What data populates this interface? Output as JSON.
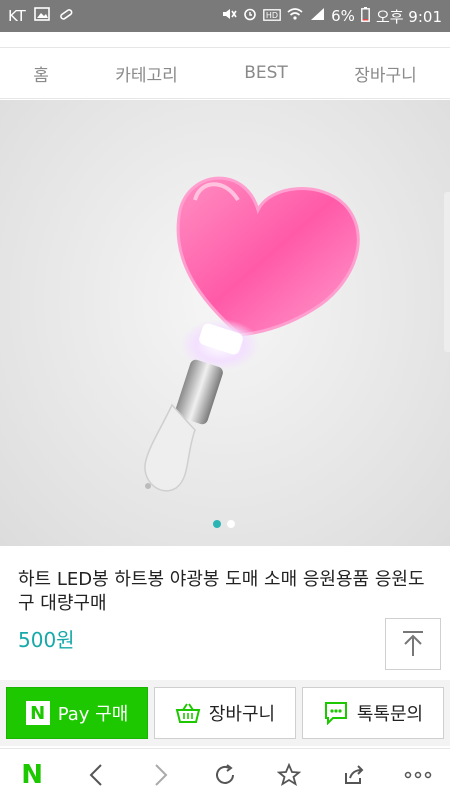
{
  "status": {
    "carrier": "KT",
    "battery": "6%",
    "time": "오후 9:01"
  },
  "nav": {
    "items": [
      "홈",
      "카테고리",
      "BEST",
      "장바구니"
    ]
  },
  "product": {
    "title": "하트 LED봉 하트봉 야광봉 도매 소매 응원용품 응원도구 대량구매",
    "price": "500원"
  },
  "actions": {
    "npay_label": "Pay 구매",
    "cart_label": "장바구니",
    "talk_label": "톡톡문의"
  },
  "colors": {
    "accent": "#17a9a9",
    "naver_green": "#1ec800"
  }
}
